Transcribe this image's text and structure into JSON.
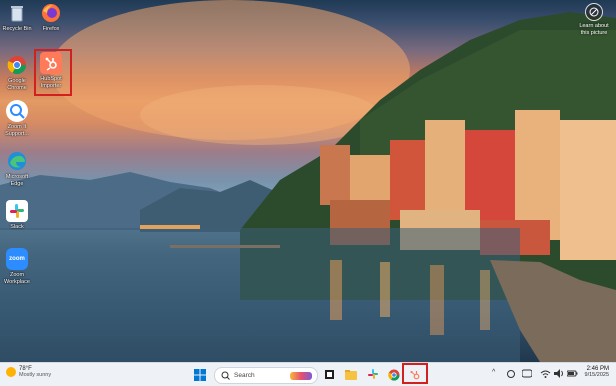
{
  "desktop": {
    "icons": [
      {
        "label": "Recycle Bin",
        "icon": "recycle-bin-icon"
      },
      {
        "label": "Firefox",
        "icon": "firefox-icon"
      },
      {
        "label": "Google Chrome",
        "icon": "chrome-icon"
      },
      {
        "label": "HubSpot Importer",
        "icon": "hubspot-icon"
      },
      {
        "label": "Zoom It Support...",
        "icon": "zoomit-icon"
      },
      {
        "label": "Microsoft Edge",
        "icon": "edge-icon"
      },
      {
        "label": "Slack",
        "icon": "slack-icon"
      },
      {
        "label": "Zoom Workplace",
        "icon": "zoom-icon"
      }
    ],
    "learn_about": {
      "line1": "Learn about",
      "line2": "this picture",
      "icon": "camera-info-icon"
    }
  },
  "taskbar": {
    "weather": {
      "temp": "78°F",
      "condition": "Mostly sunny",
      "icon": "sun-icon"
    },
    "search": {
      "placeholder": "Search",
      "icon": "search-icon"
    },
    "pinned": [
      "windows-start-icon",
      "search-box",
      "task-view-icon",
      "file-explorer-icon",
      "slack-icon",
      "chrome-icon",
      "hubspot-icon"
    ],
    "tray": {
      "chevron": "^",
      "time": "2:46 PM",
      "date": "9/15/2025"
    }
  },
  "colors": {
    "accent": "#ff7a59",
    "highlight": "#d21f1f",
    "taskbar": "#eef1f5"
  }
}
